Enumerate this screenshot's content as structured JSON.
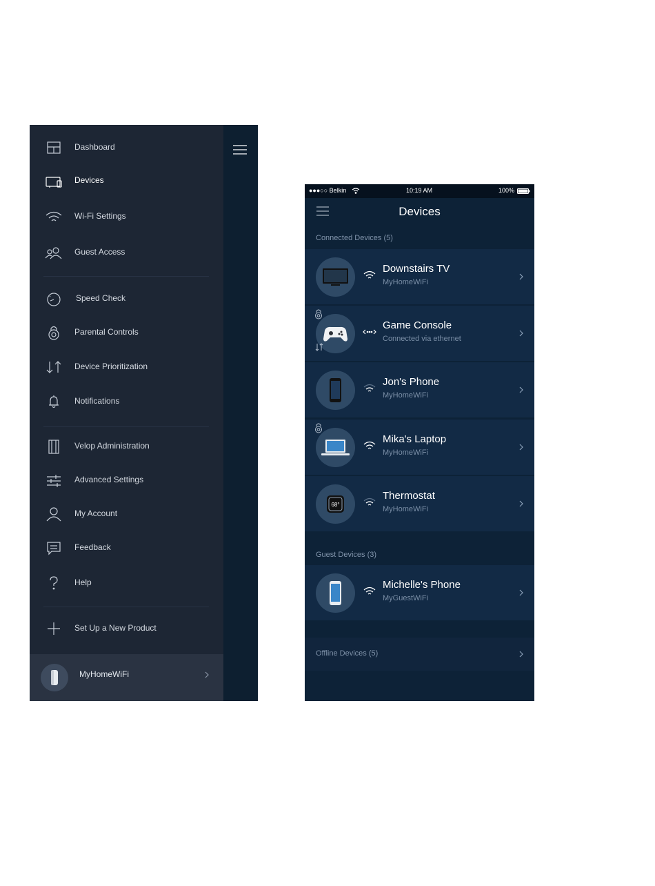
{
  "drawer": {
    "items": [
      {
        "label": "Dashboard",
        "icon": "dashboard-icon"
      },
      {
        "label": "Devices",
        "icon": "devices-icon",
        "active": true
      },
      {
        "label": "Wi-Fi Settings",
        "icon": "wifi-icon"
      },
      {
        "label": "Guest Access",
        "icon": "guest-access-icon"
      },
      {
        "label": "Speed Check",
        "icon": "speedometer-icon"
      },
      {
        "label": "Parental Controls",
        "icon": "lock-icon"
      },
      {
        "label": "Device Prioritization",
        "icon": "prioritization-icon"
      },
      {
        "label": "Notifications",
        "icon": "bell-icon"
      },
      {
        "label": "Velop Administration",
        "icon": "velop-node-icon"
      },
      {
        "label": "Advanced Settings",
        "icon": "sliders-icon"
      },
      {
        "label": "My Account",
        "icon": "user-icon"
      },
      {
        "label": "Feedback",
        "icon": "feedback-icon"
      },
      {
        "label": "Help",
        "icon": "help-icon"
      },
      {
        "label": "Set Up a New Product",
        "icon": "plus-icon"
      }
    ],
    "footer": {
      "network_name": "MyHomeWiFi"
    }
  },
  "phone": {
    "status_bar": {
      "carrier": "●●●○○ Belkin",
      "time": "10:19 AM",
      "battery": "100%"
    },
    "title": "Devices",
    "connected_label": "Connected Devices (5)",
    "connected_devices": [
      {
        "name": "Downstairs TV",
        "network": "MyHomeWiFi",
        "icon": "tv-icon",
        "connection": "wifi"
      },
      {
        "name": "Game Console",
        "network": "Connected via ethernet",
        "icon": "gamepad-icon",
        "connection": "ethernet"
      },
      {
        "name": "Jon's Phone",
        "network": "MyHomeWiFi",
        "icon": "phone-icon",
        "connection": "wifi"
      },
      {
        "name": "Mika's Laptop",
        "network": "MyHomeWiFi",
        "icon": "laptop-icon",
        "connection": "wifi"
      },
      {
        "name": "Thermostat",
        "network": "MyHomeWiFi",
        "icon": "thermostat-icon",
        "connection": "wifi",
        "thermostat_reading": "68°"
      }
    ],
    "guest_label": "Guest Devices (3)",
    "guest_devices": [
      {
        "name": "Michelle's Phone",
        "network": "MyGuestWiFi",
        "icon": "phone-icon",
        "connection": "wifi"
      }
    ],
    "offline_label": "Offline Devices (5)"
  },
  "colors": {
    "drawer_background": "#1d2634",
    "phone_background": "#0d2237",
    "row_background": "#122a45",
    "muted_text": "#7a8ea6"
  }
}
